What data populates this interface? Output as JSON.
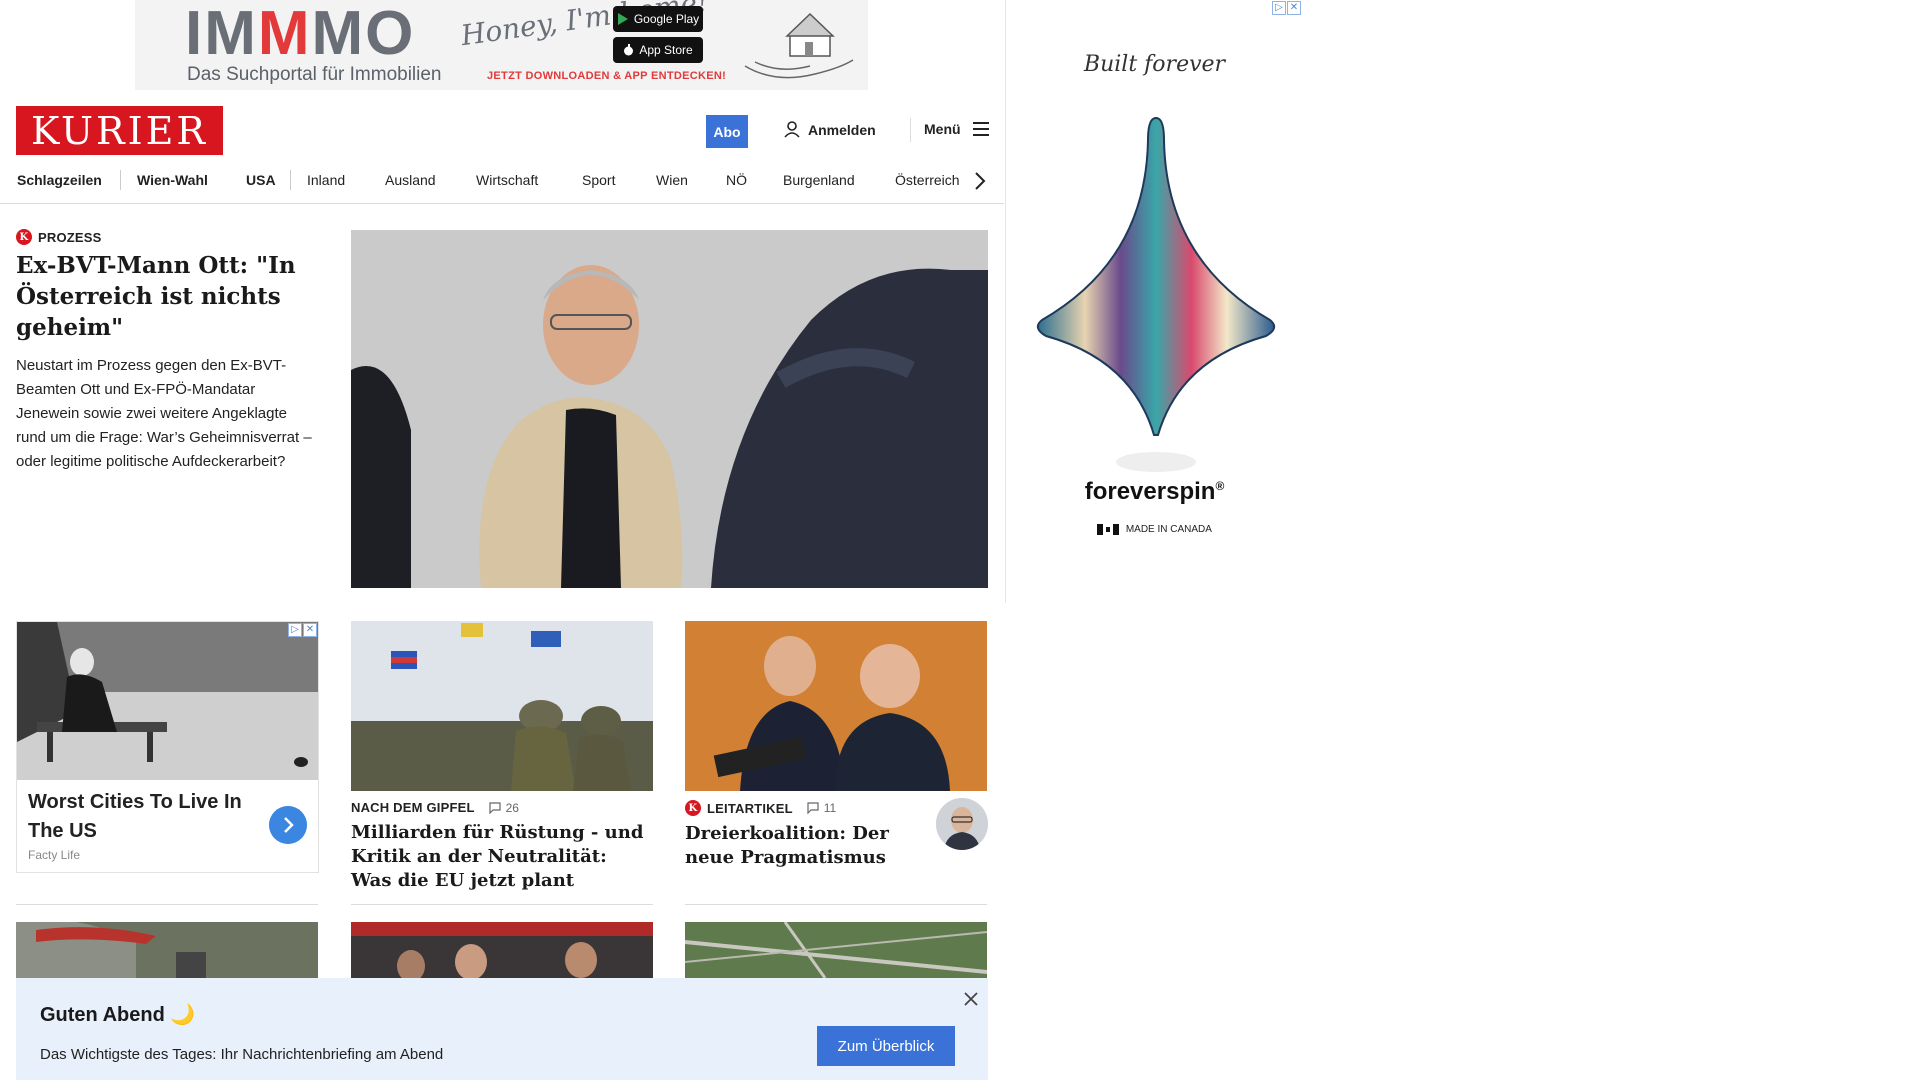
{
  "top_ad": {
    "logo_left": "IM",
    "logo_mid": "M",
    "logo_right": "MO",
    "tagline": "Das Suchportal für Immobilien",
    "script": "Honey, I'm home!",
    "google_play": "Google Play",
    "app_store": "App Store",
    "cta": "JETZT DOWNLOADEN & APP ENTDECKEN!"
  },
  "side_ad": {
    "slogan": "Built forever",
    "brand": "foreverspin",
    "brand_mark": "®",
    "made": "MADE IN CANADA"
  },
  "header": {
    "logo": "KURIER",
    "abo": "Abo",
    "login": "Anmelden",
    "menu": "Menü"
  },
  "nav": {
    "items": [
      "Schlagzeilen",
      "Wien-Wahl",
      "USA",
      "Inland",
      "Ausland",
      "Wirtschaft",
      "Sport",
      "Wien",
      "NÖ",
      "Burgenland",
      "Österreich"
    ]
  },
  "lead": {
    "kicker_icon": "K",
    "kicker": "PROZESS",
    "title": "Ex-BVT-Mann Ott: \"In Österreich ist nichts geheim\"",
    "teaser": "Neustart im Prozess gegen den Ex-BVT-Beamten Ott und Ex-FPÖ-Mandatar Jenewein sowie zwei weitere Angeklagte rund um die Frage: War’s Geheimnisverrat – oder legitime politische Aufdeckerarbeit?"
  },
  "native_ad": {
    "title": "Worst Cities To Live In The US",
    "source": "Facty Life"
  },
  "cards": [
    {
      "kicker": "NACH DEM GIPFEL",
      "comments": "26",
      "title": "Milliarden für Rüstung - und Kritik an der Neutralität: Was die EU jetzt plant"
    },
    {
      "kicker_icon": "K",
      "kicker": "LEITARTIKEL",
      "comments": "11",
      "title": "Dreierkoalition: Der neue Pragmatismus"
    }
  ],
  "briefing": {
    "greeting": "Guten Abend",
    "moon": "🌙",
    "text": "Das Wichtigste des Tages: Ihr Nachrichtenbriefing am Abend",
    "button": "Zum Überblick"
  },
  "colors": {
    "brand_red": "#d7161f",
    "accent_blue": "#3a72d8",
    "briefing_bg": "#e8f0fb"
  },
  "icons": [
    "user-icon",
    "hamburger-icon",
    "chevron-right-icon",
    "comment-icon",
    "close-icon",
    "ad-choices-icon"
  ]
}
